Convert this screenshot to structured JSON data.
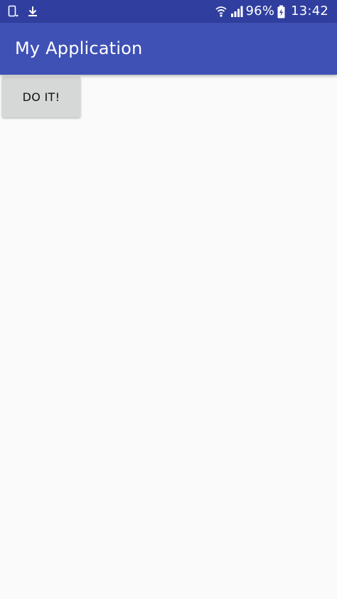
{
  "status_bar": {
    "left_icons": [
      "screen-rotate-icon",
      "download-icon"
    ],
    "right_icons": [
      "wifi-icon",
      "signal-icon",
      "battery-charging-icon"
    ],
    "battery": "96%",
    "time": "13:42",
    "background": "#303f9f"
  },
  "app_bar": {
    "title": "My Application",
    "background": "#3f51b5"
  },
  "main": {
    "button_label": "DO IT!",
    "button_color": "#d6d7d7",
    "background": "#fafafa"
  }
}
